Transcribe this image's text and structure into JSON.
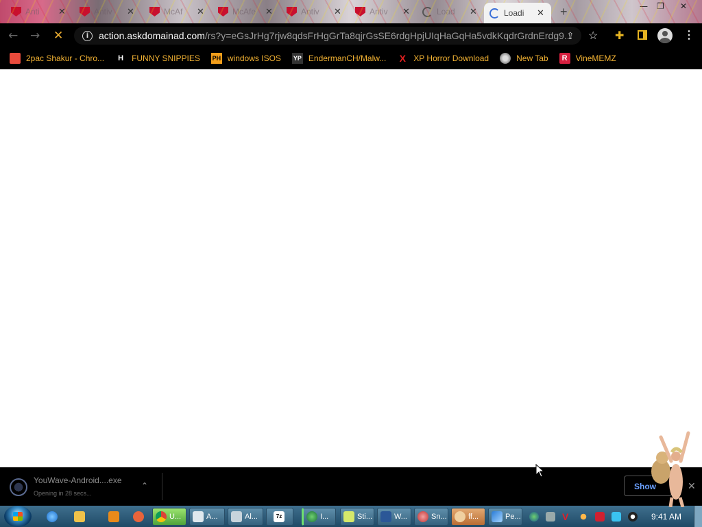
{
  "tabs": [
    {
      "label": "Anti",
      "icon": "mcafee-shield-icon"
    },
    {
      "label": "Antiv",
      "icon": "mcafee-shield-icon"
    },
    {
      "label": "McAf",
      "icon": "mcafee-shield-icon"
    },
    {
      "label": "McAfe",
      "icon": "mcafee-shield-icon"
    },
    {
      "label": "Antiv",
      "icon": "mcafee-shield-icon"
    },
    {
      "label": "Antiv",
      "icon": "mcafee-shield-icon"
    },
    {
      "label": "Load",
      "icon": "loading-spinner-icon"
    },
    {
      "label": "Loadi",
      "icon": "loading-spinner-icon"
    }
  ],
  "toolbar": {
    "url_host": "action.askdomainad.com",
    "url_path": "/rs?y=eGsJrHg7rjw8qdsFrHgGrTa8qjrGsSE6rdgHpjUIqHaGqHa5vdkKqdrGrdnErdg9...",
    "info_glyph": "i"
  },
  "bookmarks": [
    {
      "label": "2pac Shakur - Chro...",
      "icon": "bag-icon",
      "icon_color": "#e94b3c"
    },
    {
      "label": "FUNNY SNIPPIES",
      "icon": "h-icon",
      "icon_color": "#ffffff"
    },
    {
      "label": "windows ISOS",
      "icon": "ph-icon",
      "icon_color": "#f29e1b"
    },
    {
      "label": "EndermanCH/Malw...",
      "icon": "yp-icon",
      "icon_color": "#333333"
    },
    {
      "label": "XP Horror Download",
      "icon": "x-icon",
      "icon_color": "#e02020"
    },
    {
      "label": "New Tab",
      "icon": "globe-icon",
      "icon_color": "#aaaaaa"
    },
    {
      "label": "VineMEMZ",
      "icon": "r-icon",
      "icon_color": "#d61f3f"
    }
  ],
  "download": {
    "filename": "YouWave-Android....exe",
    "status": "Opening in 28 secs...",
    "show_all_label": "Show"
  },
  "taskbar": {
    "items": [
      {
        "label": "U...",
        "icon": "chrome-icon"
      },
      {
        "label": "A...",
        "icon": "window-icon"
      },
      {
        "label": "Al...",
        "icon": "window-icon"
      },
      {
        "label": "",
        "icon": "7zip-icon"
      },
      {
        "label": "I...",
        "icon": "globe-icon"
      },
      {
        "label": "Sti...",
        "icon": "sticky-notes-icon"
      },
      {
        "label": "W...",
        "icon": "word-icon"
      },
      {
        "label": "Sn...",
        "icon": "snipping-tool-icon"
      },
      {
        "label": "ff...",
        "icon": "paint-icon"
      },
      {
        "label": "Pe...",
        "icon": "chart-icon"
      }
    ],
    "clock": "9:41 AM"
  }
}
